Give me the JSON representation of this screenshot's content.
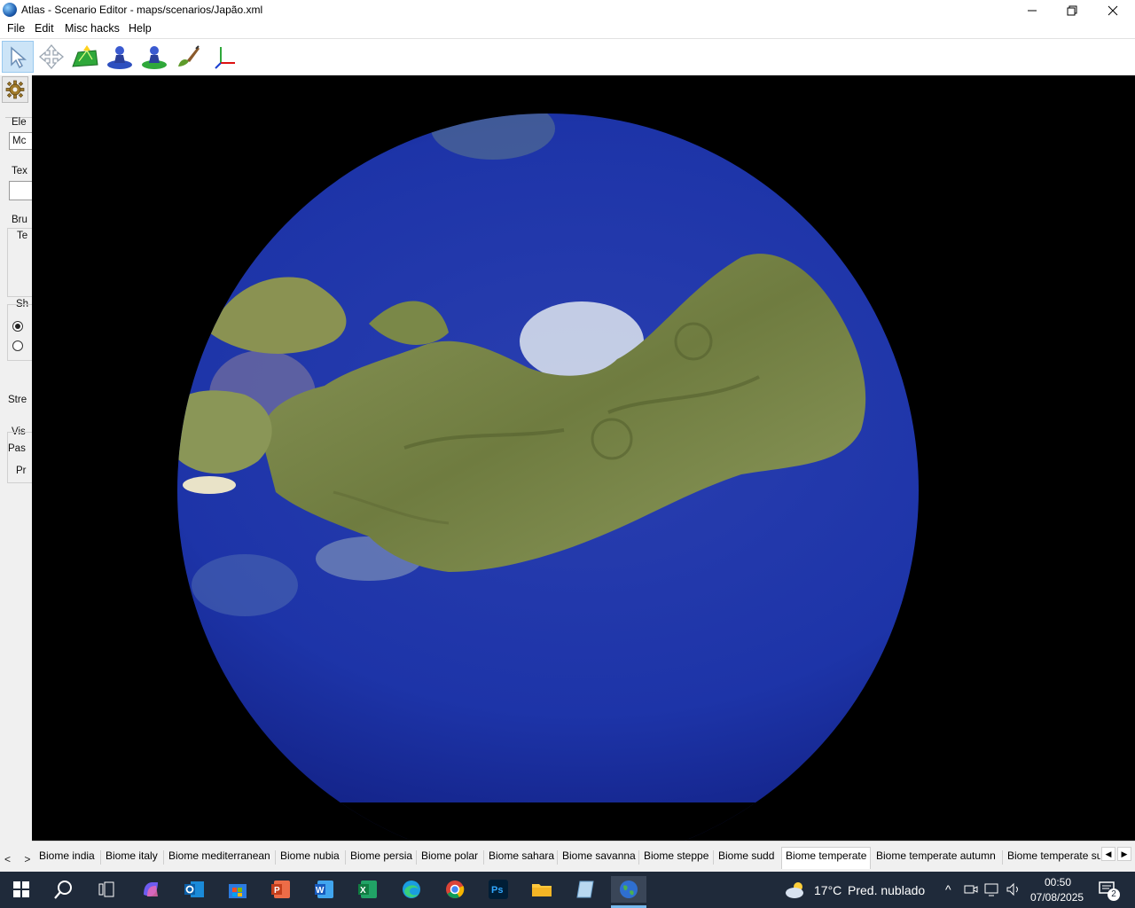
{
  "window": {
    "title": "Atlas - Scenario Editor - maps/scenarios/Japão.xml",
    "minimize": "—",
    "maximize": "❐",
    "close": "✕"
  },
  "menu": [
    "File",
    "Edit",
    "Misc hacks",
    "Help"
  ],
  "toolbar_icons": [
    "select-arrow-icon",
    "move-arrows-icon",
    "terrain-elevation-icon",
    "unit-placement-icon",
    "player-unit-icon",
    "paint-brush-icon",
    "axis-gizmo-icon"
  ],
  "left_panel": {
    "labels": {
      "elevation": "Ele",
      "elevation_select": "Mc",
      "texture": "Tex",
      "brush": "Bru",
      "brush_sub": "Te",
      "shape": "Sh",
      "strength": "Stre",
      "visualize": "Vis",
      "passability": "Pas",
      "preview": "Pr"
    }
  },
  "tabs": [
    "Biome india",
    "Biome italy",
    "Biome mediterranean",
    "Biome nubia",
    "Biome persia",
    "Biome polar",
    "Biome sahara",
    "Biome savanna",
    "Biome steppe",
    "Biome sudd",
    "Biome temperate",
    "Biome temperate autumn",
    "Biome temperate su"
  ],
  "active_tab": "Biome temperate",
  "tab_scroll": {
    "left": "◀",
    "right": "▶"
  },
  "panel_arrows": "< >",
  "taskbar": {
    "weather_temp": "17°C",
    "weather_desc": "Pred. nublado",
    "time": "00:50",
    "date": "07/08/2025",
    "notifications": "2",
    "tray_chevron": "^"
  },
  "colors": {
    "ocean": "#1b2f9c",
    "land": "#7d8a4e",
    "taskbar": "#1f2a3a",
    "toolbar_active": "#cce4f7"
  }
}
